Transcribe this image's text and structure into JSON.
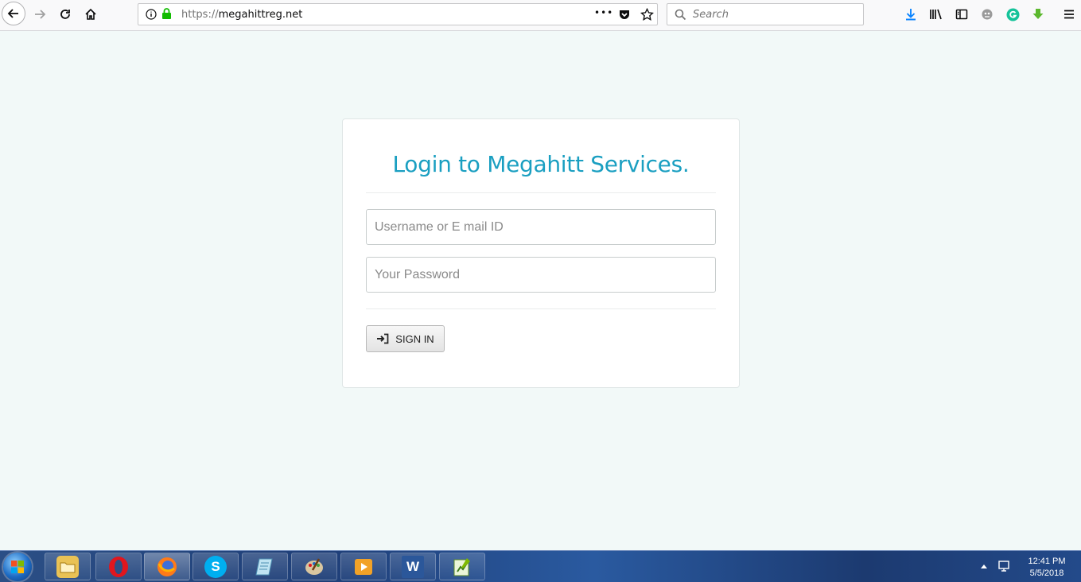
{
  "browser": {
    "url_scheme": "https://",
    "url_host": "megahittreg.net",
    "search_placeholder": "Search",
    "page_actions_label": "•••"
  },
  "login": {
    "title": "Login to Megahitt Services.",
    "username_placeholder": "Username or E mail ID",
    "username_value": "",
    "password_placeholder": "Your Password",
    "password_value": "",
    "signin_label": "SIGN IN"
  },
  "taskbar": {
    "apps": [
      "file-explorer",
      "opera",
      "firefox",
      "skype",
      "notepad",
      "paint",
      "media-player",
      "word",
      "chart-app"
    ],
    "time": "12:41 PM",
    "date": "5/5/2018"
  },
  "colors": {
    "page_background": "#f2f9f8",
    "title_accent": "#1a9fc1",
    "lock_green": "#12bc00"
  }
}
